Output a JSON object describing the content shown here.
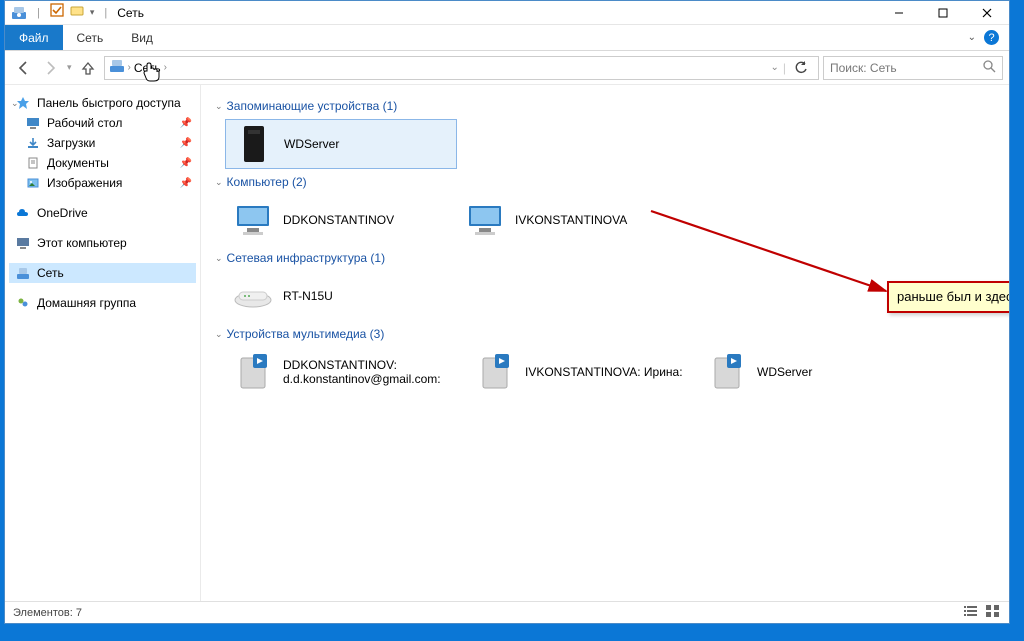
{
  "titlebar": {
    "title": "Сеть",
    "separator": "|"
  },
  "ribbon": {
    "file": "Файл",
    "tabs": [
      "Сеть",
      "Вид"
    ]
  },
  "nav": {
    "breadcrumb": "Сеть",
    "chevron": "›",
    "dropdown": "⌄",
    "refresh": "⟳"
  },
  "search": {
    "placeholder": "Поиск: Сеть"
  },
  "sidebar": {
    "quick_access": "Панель быстрого доступа",
    "pinned": [
      {
        "label": "Рабочий стол"
      },
      {
        "label": "Загрузки"
      },
      {
        "label": "Документы"
      },
      {
        "label": "Изображения"
      }
    ],
    "onedrive": "OneDrive",
    "this_pc": "Этот компьютер",
    "network": "Сеть",
    "homegroup": "Домашняя группа"
  },
  "groups": {
    "storage": {
      "title": "Запоминающие устройства (1)",
      "items": [
        "WDServer"
      ]
    },
    "computers": {
      "title": "Компьютер (2)",
      "items": [
        "DDKONSTANTINOV",
        "IVKONSTANTINOVA"
      ]
    },
    "infra": {
      "title": "Сетевая инфраструктура (1)",
      "items": [
        "RT-N15U"
      ]
    },
    "media": {
      "title": "Устройства мультимедиа (3)",
      "items": [
        "DDKONSTANTINOV: d.d.konstantinov@gmail.com:",
        "IVKONSTANTINOVA: Ирина:",
        "WDServer"
      ]
    }
  },
  "annotation": {
    "text": "раньше был и здесь"
  },
  "statusbar": {
    "text": "Элементов: 7"
  }
}
